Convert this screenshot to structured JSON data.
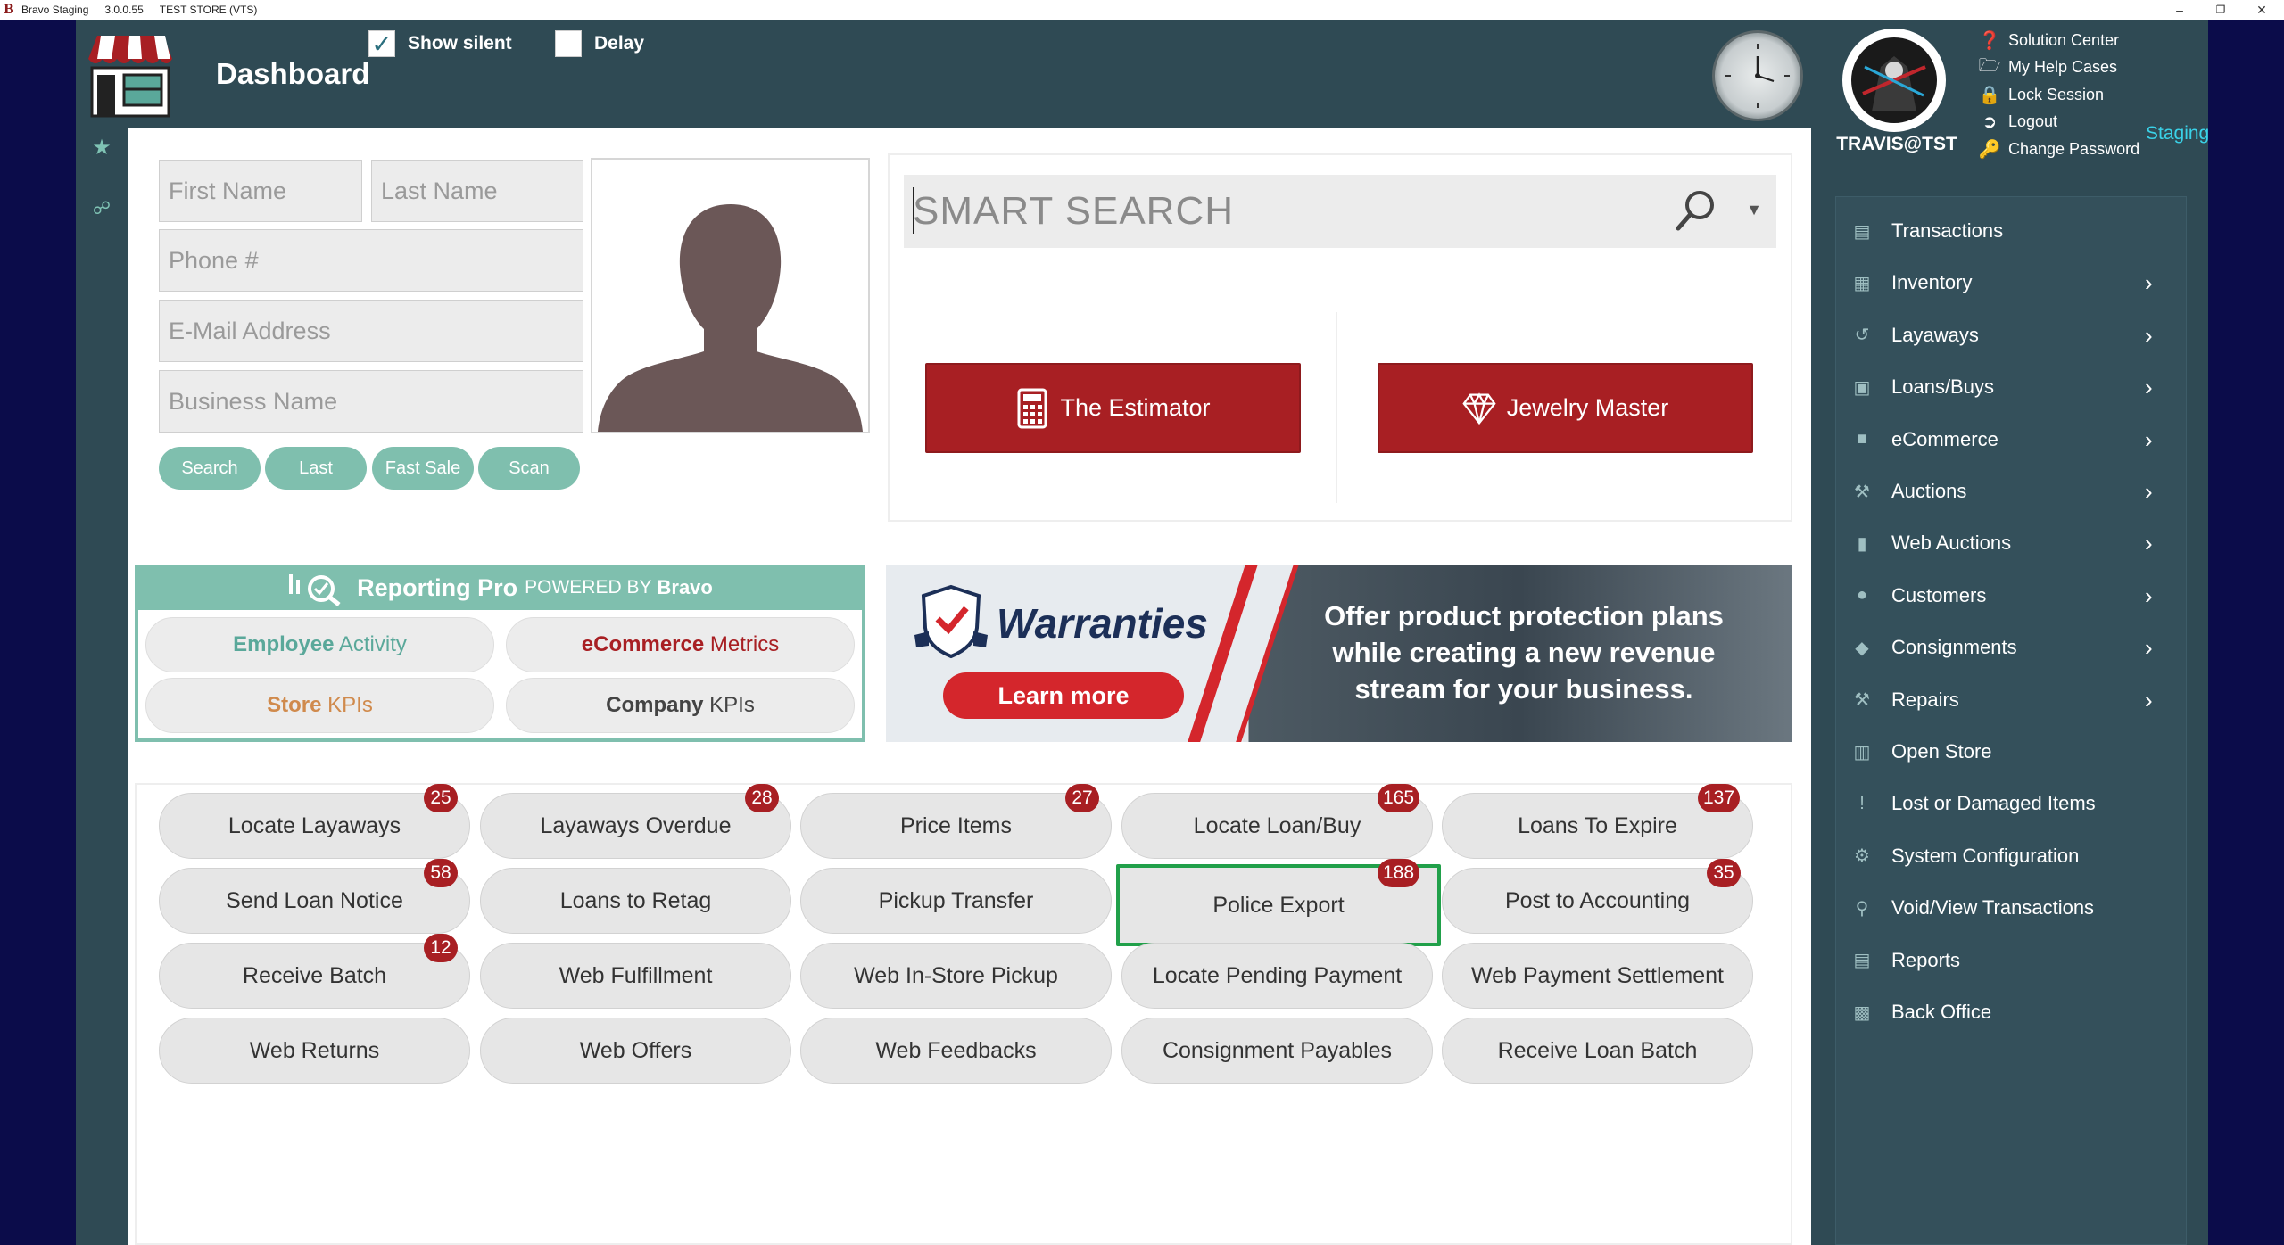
{
  "titlebar": {
    "app_name": "Bravo Staging",
    "version": "3.0.0.55",
    "store": "TEST STORE (VTS)",
    "minimize": "–",
    "restore": "❐",
    "close": "✕"
  },
  "header": {
    "title": "Dashboard",
    "show_silent": {
      "label": "Show silent",
      "checked": true
    },
    "delay": {
      "label": "Delay",
      "checked": false
    },
    "username": "TRAVIS@TST",
    "staging_label": "Staging",
    "user_menu": [
      {
        "label": "Solution Center",
        "icon": "question-circle-icon"
      },
      {
        "label": "My Help Cases",
        "icon": "folder-icon"
      },
      {
        "label": "Lock Session",
        "icon": "lock-icon"
      },
      {
        "label": "Logout",
        "icon": "logout-icon"
      },
      {
        "label": "Change Password",
        "icon": "key-icon"
      }
    ]
  },
  "customer_form": {
    "first_name_placeholder": "First Name",
    "last_name_placeholder": "Last Name",
    "phone_placeholder": "Phone #",
    "email_placeholder": "E-Mail Address",
    "business_placeholder": "Business Name",
    "buttons": [
      "Search",
      "Last",
      "Fast Sale",
      "Scan"
    ]
  },
  "smart_search": {
    "placeholder": "SMART SEARCH"
  },
  "quick_buttons": {
    "estimator": "The Estimator",
    "jewelry_master": "Jewelry Master"
  },
  "reporting": {
    "title": "Reporting Pro",
    "powered_by": "POWERED BY",
    "brand": "Bravo",
    "buttons": [
      {
        "bold": "Employee",
        "rest": " Activity",
        "color": "#5aa89a"
      },
      {
        "bold": "eCommerce",
        "rest": " Metrics",
        "color": "#a81f23"
      },
      {
        "bold": "Store",
        "rest": " KPIs",
        "color": "#d08a4c"
      },
      {
        "bold": "Company",
        "rest": " KPIs",
        "color": "#444444"
      }
    ]
  },
  "warranties_banner": {
    "title": "Warranties",
    "cta": "Learn more",
    "text_lines": [
      "Offer product protection plans",
      "while creating a new revenue",
      "stream for your business."
    ]
  },
  "tiles": [
    {
      "label": "Locate Layaways",
      "badge": "25"
    },
    {
      "label": "Layaways Overdue",
      "badge": "28"
    },
    {
      "label": "Price Items",
      "badge": "27"
    },
    {
      "label": "Locate Loan/Buy",
      "badge": "165"
    },
    {
      "label": "Loans To Expire",
      "badge": "137"
    },
    {
      "label": "Send Loan Notice",
      "badge": "58"
    },
    {
      "label": "Loans to Retag",
      "badge": ""
    },
    {
      "label": "Pickup Transfer",
      "badge": ""
    },
    {
      "label": "Police Export",
      "badge": "188",
      "selected": true
    },
    {
      "label": "Post to Accounting",
      "badge": "35"
    },
    {
      "label": "Receive Batch",
      "badge": "12"
    },
    {
      "label": "Web Fulfillment",
      "badge": ""
    },
    {
      "label": "Web In-Store Pickup",
      "badge": ""
    },
    {
      "label": "Locate Pending Payment",
      "badge": ""
    },
    {
      "label": "Web Payment Settlement",
      "badge": ""
    },
    {
      "label": "Web Returns",
      "badge": ""
    },
    {
      "label": "Web Offers",
      "badge": ""
    },
    {
      "label": "Web Feedbacks",
      "badge": ""
    },
    {
      "label": "Consignment Payables",
      "badge": ""
    },
    {
      "label": "Receive Loan Batch",
      "badge": ""
    }
  ],
  "nav": [
    {
      "label": "Transactions",
      "icon": "transactions-icon",
      "glyph": "▤",
      "chevron": false
    },
    {
      "label": "Inventory",
      "icon": "inventory-icon",
      "glyph": "▦",
      "chevron": true
    },
    {
      "label": "Layaways",
      "icon": "layaways-icon",
      "glyph": "↺",
      "chevron": true
    },
    {
      "label": "Loans/Buys",
      "icon": "loans-icon",
      "glyph": "▣",
      "chevron": true
    },
    {
      "label": "eCommerce",
      "icon": "cart-icon",
      "glyph": "■",
      "chevron": true
    },
    {
      "label": "Auctions",
      "icon": "gavel-icon",
      "glyph": "⚒",
      "chevron": true
    },
    {
      "label": "Web Auctions",
      "icon": "mouse-icon",
      "glyph": "▮",
      "chevron": true
    },
    {
      "label": "Customers",
      "icon": "user-icon",
      "glyph": "●",
      "chevron": true
    },
    {
      "label": "Consignments",
      "icon": "tags-icon",
      "glyph": "◆",
      "chevron": true
    },
    {
      "label": "Repairs",
      "icon": "wrench-icon",
      "glyph": "⚒",
      "chevron": true
    },
    {
      "label": "Open Store",
      "icon": "store-icon",
      "glyph": "▥",
      "chevron": false
    },
    {
      "label": "Lost or Damaged Items",
      "icon": "alert-icon",
      "glyph": "!",
      "chevron": false
    },
    {
      "label": "System Configuration",
      "icon": "cogs-icon",
      "glyph": "⚙",
      "chevron": false
    },
    {
      "label": "Void/View Transactions",
      "icon": "search-icon",
      "glyph": "⚲",
      "chevron": false
    },
    {
      "label": "Reports",
      "icon": "report-icon",
      "glyph": "▤",
      "chevron": false
    },
    {
      "label": "Back Office",
      "icon": "briefcase-icon",
      "glyph": "▩",
      "chevron": false
    }
  ],
  "colors": {
    "app_bg": "#2f4a54",
    "accent_red": "#a81f23",
    "accent_teal": "#7fbfae",
    "selected_green": "#21a04a",
    "staging": "#3ad2e8"
  }
}
